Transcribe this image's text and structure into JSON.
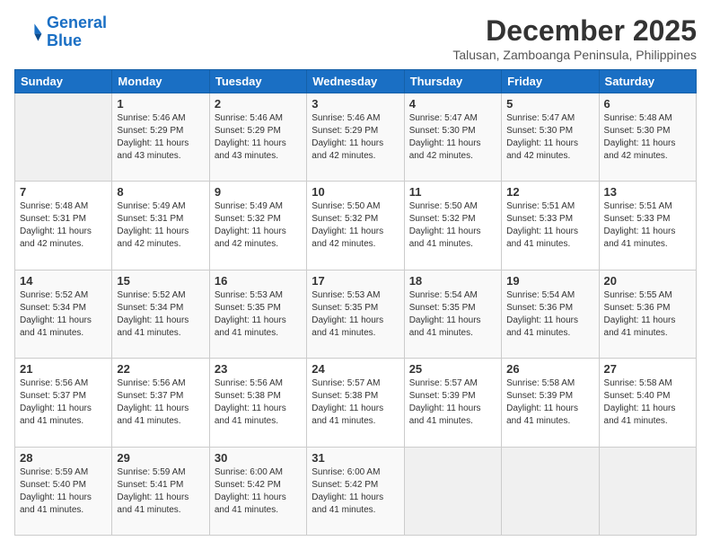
{
  "logo": {
    "line1": "General",
    "line2": "Blue"
  },
  "title": "December 2025",
  "subtitle": "Talusan, Zamboanga Peninsula, Philippines",
  "days_header": [
    "Sunday",
    "Monday",
    "Tuesday",
    "Wednesday",
    "Thursday",
    "Friday",
    "Saturday"
  ],
  "weeks": [
    [
      {
        "day": "",
        "info": ""
      },
      {
        "day": "1",
        "info": "Sunrise: 5:46 AM\nSunset: 5:29 PM\nDaylight: 11 hours\nand 43 minutes."
      },
      {
        "day": "2",
        "info": "Sunrise: 5:46 AM\nSunset: 5:29 PM\nDaylight: 11 hours\nand 43 minutes."
      },
      {
        "day": "3",
        "info": "Sunrise: 5:46 AM\nSunset: 5:29 PM\nDaylight: 11 hours\nand 42 minutes."
      },
      {
        "day": "4",
        "info": "Sunrise: 5:47 AM\nSunset: 5:30 PM\nDaylight: 11 hours\nand 42 minutes."
      },
      {
        "day": "5",
        "info": "Sunrise: 5:47 AM\nSunset: 5:30 PM\nDaylight: 11 hours\nand 42 minutes."
      },
      {
        "day": "6",
        "info": "Sunrise: 5:48 AM\nSunset: 5:30 PM\nDaylight: 11 hours\nand 42 minutes."
      }
    ],
    [
      {
        "day": "7",
        "info": "Sunrise: 5:48 AM\nSunset: 5:31 PM\nDaylight: 11 hours\nand 42 minutes."
      },
      {
        "day": "8",
        "info": "Sunrise: 5:49 AM\nSunset: 5:31 PM\nDaylight: 11 hours\nand 42 minutes."
      },
      {
        "day": "9",
        "info": "Sunrise: 5:49 AM\nSunset: 5:32 PM\nDaylight: 11 hours\nand 42 minutes."
      },
      {
        "day": "10",
        "info": "Sunrise: 5:50 AM\nSunset: 5:32 PM\nDaylight: 11 hours\nand 42 minutes."
      },
      {
        "day": "11",
        "info": "Sunrise: 5:50 AM\nSunset: 5:32 PM\nDaylight: 11 hours\nand 41 minutes."
      },
      {
        "day": "12",
        "info": "Sunrise: 5:51 AM\nSunset: 5:33 PM\nDaylight: 11 hours\nand 41 minutes."
      },
      {
        "day": "13",
        "info": "Sunrise: 5:51 AM\nSunset: 5:33 PM\nDaylight: 11 hours\nand 41 minutes."
      }
    ],
    [
      {
        "day": "14",
        "info": "Sunrise: 5:52 AM\nSunset: 5:34 PM\nDaylight: 11 hours\nand 41 minutes."
      },
      {
        "day": "15",
        "info": "Sunrise: 5:52 AM\nSunset: 5:34 PM\nDaylight: 11 hours\nand 41 minutes."
      },
      {
        "day": "16",
        "info": "Sunrise: 5:53 AM\nSunset: 5:35 PM\nDaylight: 11 hours\nand 41 minutes."
      },
      {
        "day": "17",
        "info": "Sunrise: 5:53 AM\nSunset: 5:35 PM\nDaylight: 11 hours\nand 41 minutes."
      },
      {
        "day": "18",
        "info": "Sunrise: 5:54 AM\nSunset: 5:35 PM\nDaylight: 11 hours\nand 41 minutes."
      },
      {
        "day": "19",
        "info": "Sunrise: 5:54 AM\nSunset: 5:36 PM\nDaylight: 11 hours\nand 41 minutes."
      },
      {
        "day": "20",
        "info": "Sunrise: 5:55 AM\nSunset: 5:36 PM\nDaylight: 11 hours\nand 41 minutes."
      }
    ],
    [
      {
        "day": "21",
        "info": "Sunrise: 5:56 AM\nSunset: 5:37 PM\nDaylight: 11 hours\nand 41 minutes."
      },
      {
        "day": "22",
        "info": "Sunrise: 5:56 AM\nSunset: 5:37 PM\nDaylight: 11 hours\nand 41 minutes."
      },
      {
        "day": "23",
        "info": "Sunrise: 5:56 AM\nSunset: 5:38 PM\nDaylight: 11 hours\nand 41 minutes."
      },
      {
        "day": "24",
        "info": "Sunrise: 5:57 AM\nSunset: 5:38 PM\nDaylight: 11 hours\nand 41 minutes."
      },
      {
        "day": "25",
        "info": "Sunrise: 5:57 AM\nSunset: 5:39 PM\nDaylight: 11 hours\nand 41 minutes."
      },
      {
        "day": "26",
        "info": "Sunrise: 5:58 AM\nSunset: 5:39 PM\nDaylight: 11 hours\nand 41 minutes."
      },
      {
        "day": "27",
        "info": "Sunrise: 5:58 AM\nSunset: 5:40 PM\nDaylight: 11 hours\nand 41 minutes."
      }
    ],
    [
      {
        "day": "28",
        "info": "Sunrise: 5:59 AM\nSunset: 5:40 PM\nDaylight: 11 hours\nand 41 minutes."
      },
      {
        "day": "29",
        "info": "Sunrise: 5:59 AM\nSunset: 5:41 PM\nDaylight: 11 hours\nand 41 minutes."
      },
      {
        "day": "30",
        "info": "Sunrise: 6:00 AM\nSunset: 5:42 PM\nDaylight: 11 hours\nand 41 minutes."
      },
      {
        "day": "31",
        "info": "Sunrise: 6:00 AM\nSunset: 5:42 PM\nDaylight: 11 hours\nand 41 minutes."
      },
      {
        "day": "",
        "info": ""
      },
      {
        "day": "",
        "info": ""
      },
      {
        "day": "",
        "info": ""
      }
    ]
  ]
}
